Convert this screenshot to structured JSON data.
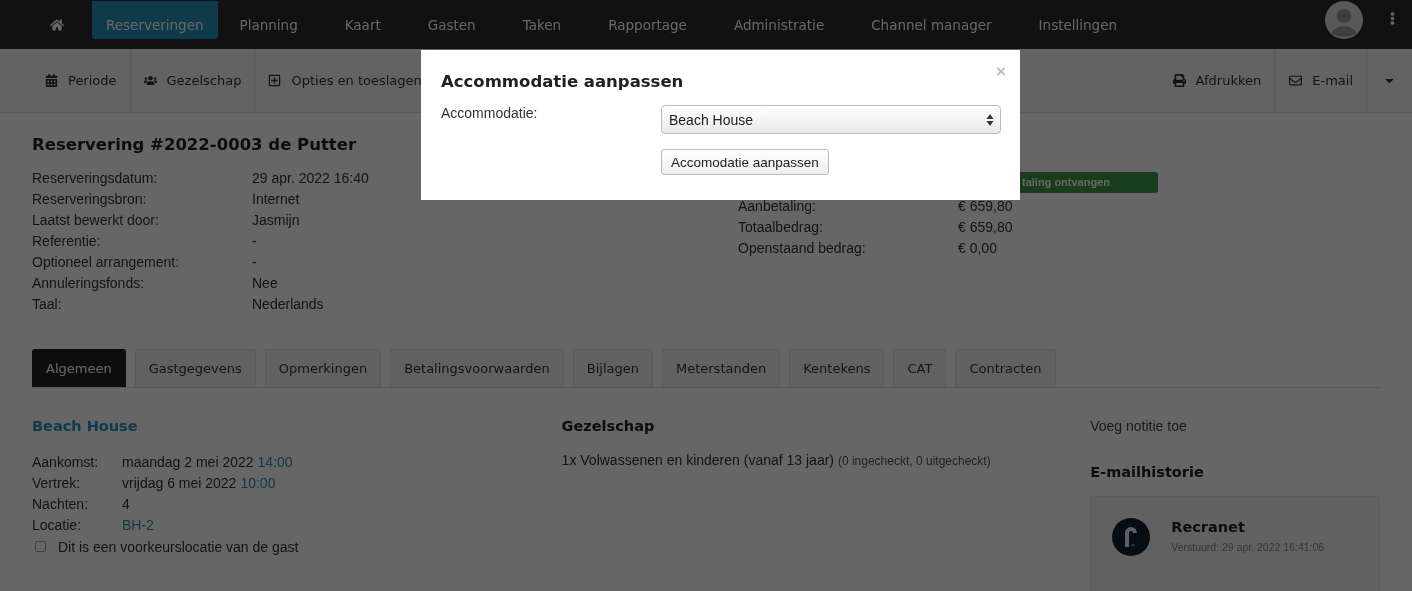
{
  "nav": {
    "items": [
      {
        "label": "Reserveringen",
        "selected": true
      },
      {
        "label": "Planning",
        "selected": false
      },
      {
        "label": "Kaart",
        "selected": false
      },
      {
        "label": "Gasten",
        "selected": false
      },
      {
        "label": "Taken",
        "selected": false
      },
      {
        "label": "Rapportage",
        "selected": false
      },
      {
        "label": "Administratie",
        "selected": false
      },
      {
        "label": "Channel manager",
        "selected": false
      },
      {
        "label": "Instellingen",
        "selected": false
      }
    ]
  },
  "toolbar": {
    "left": [
      {
        "label": "Periode",
        "kind": "calendar"
      },
      {
        "label": "Gezelschap",
        "kind": "users"
      },
      {
        "label": "Opties en toeslagen",
        "kind": "plus"
      }
    ],
    "right": [
      {
        "label": "Afdrukken",
        "kind": "print"
      },
      {
        "label": "E-mail",
        "kind": "mail"
      }
    ]
  },
  "reservation": {
    "title": "Reservering #2022-0003 de Putter",
    "details": [
      {
        "label": "Reserveringsdatum:",
        "value": "29 apr. 2022 16:40"
      },
      {
        "label": "Reserveringsbron:",
        "value": "Internet"
      },
      {
        "label": "Laatst bewerkt door:",
        "value": "Jasmijn"
      },
      {
        "label": "Referentie:",
        "value": "-"
      },
      {
        "label": "Optioneel arrangement:",
        "value": "-"
      },
      {
        "label": "Annuleringsfonds:",
        "value": "Nee"
      },
      {
        "label": "Taal:",
        "value": "Nederlands"
      }
    ],
    "payment_badge": "taling ontvangen",
    "payments": [
      {
        "label": "Aanbetaling:",
        "value": "€ 659,80"
      },
      {
        "label": "Totaalbedrag:",
        "value": "€ 659,80"
      },
      {
        "label": "Openstaand bedrag:",
        "value": "€ 0,00"
      }
    ]
  },
  "tabs": [
    {
      "label": "Algemeen",
      "selected": true
    },
    {
      "label": "Gastgegevens",
      "selected": false
    },
    {
      "label": "Opmerkingen",
      "selected": false
    },
    {
      "label": "Betalingsvoorwaarden",
      "selected": false
    },
    {
      "label": "Bijlagen",
      "selected": false
    },
    {
      "label": "Meterstanden",
      "selected": false
    },
    {
      "label": "Kentekens",
      "selected": false
    },
    {
      "label": "CAT",
      "selected": false
    },
    {
      "label": "Contracten",
      "selected": false
    }
  ],
  "accommodation": {
    "title": "Beach House",
    "rows": [
      {
        "label": "Aankomst:",
        "value": "maandag 2 mei 2022",
        "time": "14:00",
        "kind": "date"
      },
      {
        "label": "Vertrek:",
        "value": "vrijdag 6 mei 2022",
        "time": "10:00",
        "kind": "date"
      },
      {
        "label": "Nachten:",
        "value": "4",
        "kind": "text"
      },
      {
        "label": "Locatie:",
        "value": "BH-2",
        "kind": "link"
      }
    ],
    "preferred": {
      "label": "Dit is een voorkeurslocatie van de gast",
      "checked": false
    }
  },
  "party": {
    "title": "Gezelschap",
    "line": "1x Volwassenen en kinderen (vanaf 13 jaar)",
    "note": "(0 ingecheckt, 0 uitgecheckt)"
  },
  "side": {
    "add_note": "Voeg notitie toe",
    "history_title": "E-mailhistorie",
    "email": {
      "sender": "Recranet",
      "sent": "Verstuurd: 29 apr. 2022 16:41:06"
    }
  },
  "modal": {
    "title": "Accommodatie aanpassen",
    "close": "×",
    "field_label": "Accommodatie:",
    "value": "Beach House",
    "button": "Accomodatie aanpassen"
  }
}
